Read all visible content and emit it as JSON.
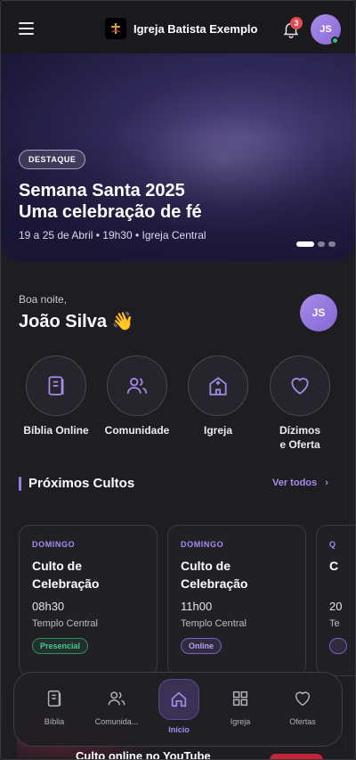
{
  "header": {
    "church_name": "Igreja Batista Exemplo",
    "notification_count": "3",
    "avatar_initials": "JS"
  },
  "hero": {
    "badge": "DESTAQUE",
    "title_line1": "Semana Santa 2025",
    "title_line2": "Uma celebração de fé",
    "subtitle": "19 a 25 de Abril • 19h30 • Igreja Central",
    "slides": 3,
    "active_slide": 1
  },
  "greeting": {
    "salutation": "Boa noite,",
    "name": "João Silva 👋",
    "avatar_initials": "JS"
  },
  "quick_actions": [
    {
      "label": "Bíblia Online",
      "icon": "book-icon"
    },
    {
      "label": "Comunidade",
      "icon": "users-icon"
    },
    {
      "label": "Igreja",
      "icon": "church-icon"
    },
    {
      "label_line1": "Dízimos",
      "label_line2": "e Oferta",
      "icon": "heart-icon"
    }
  ],
  "services_section": {
    "title": "Próximos Cultos",
    "see_all": "Ver todos"
  },
  "services": [
    {
      "day": "DOMINGO",
      "title_line1": "Culto de",
      "title_line2": "Celebração",
      "time": "08h30",
      "place": "Templo Central",
      "tag": "Presencial"
    },
    {
      "day": "DOMINGO",
      "title_line1": "Culto de",
      "title_line2": "Celebração",
      "time": "11h00",
      "place": "Templo Central",
      "tag": "Online"
    },
    {
      "day": "Q",
      "title_line1": "C",
      "title_line2": "",
      "time": "20",
      "place": "Te",
      "tag": ""
    }
  ],
  "peek": {
    "title": "Culto online no YouTube"
  },
  "bottom_nav": [
    {
      "label": "Bíblia",
      "icon": "book-icon"
    },
    {
      "label": "Comunida...",
      "icon": "users-icon"
    },
    {
      "label": "Início",
      "icon": "home-icon",
      "active": true
    },
    {
      "label": "Igreja",
      "icon": "grid-icon"
    },
    {
      "label": "Ofertas",
      "icon": "heart-icon"
    }
  ],
  "colors": {
    "accent": "#a98bf0",
    "background": "#1e1d22",
    "notification": "#e5484d",
    "online": "#2ec27e"
  }
}
